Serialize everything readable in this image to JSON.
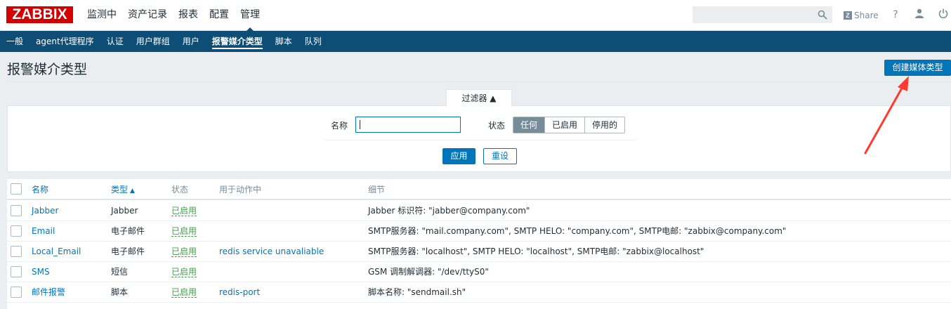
{
  "brand": {
    "logo": "ZABBIX"
  },
  "main_nav": [
    "监测中",
    "资产记录",
    "报表",
    "配置",
    "管理"
  ],
  "main_nav_active": 4,
  "header_tools": {
    "search_value": "",
    "share_label": "Share",
    "help_glyph": "?",
    "user_glyph": "👤",
    "power_glyph": "⏻"
  },
  "sub_nav": [
    "一般",
    "agent代理程序",
    "认证",
    "用户群组",
    "用户",
    "报警媒介类型",
    "脚本",
    "队列"
  ],
  "sub_nav_active": 5,
  "page": {
    "title": "报警媒介类型",
    "create_button": "创建媒体类型"
  },
  "filter": {
    "tab_label": "过滤器 ▲",
    "name_label": "名称",
    "name_value": "",
    "status_label": "状态",
    "status_options": [
      "任何",
      "已启用",
      "停用的"
    ],
    "status_selected": 0,
    "apply_label": "应用",
    "reset_label": "重设"
  },
  "table": {
    "headers": {
      "name": "名称",
      "type": "类型",
      "type_sort": "▲",
      "status": "状态",
      "used_in_actions": "用于动作中",
      "details": "细节"
    },
    "rows": [
      {
        "name": "Jabber",
        "type": "Jabber",
        "status": "已启用",
        "actions": "",
        "details": "Jabber 标识符: \"jabber@company.com\""
      },
      {
        "name": "Email",
        "type": "电子邮件",
        "status": "已启用",
        "actions": "",
        "details": "SMTP服务器: \"mail.company.com\", SMTP HELO: \"company.com\", SMTP电邮: \"zabbix@company.com\""
      },
      {
        "name": "Local_Email",
        "type": "电子邮件",
        "status": "已启用",
        "actions": "redis service unavaliable",
        "details": "SMTP服务器: \"localhost\", SMTP HELO: \"localhost\", SMTP电邮: \"zabbix@localhost\""
      },
      {
        "name": "SMS",
        "type": "短信",
        "status": "已启用",
        "actions": "",
        "details": "GSM 调制解调器: \"/dev/ttyS0\""
      },
      {
        "name": "邮件报警",
        "type": "脚本",
        "status": "已启用",
        "actions": "redis-port",
        "details": "脚本名称: \"sendmail.sh\""
      }
    ]
  },
  "colors": {
    "accent": "#0275b8",
    "nav_dark": "#0e4d75",
    "logo_red": "#d40000",
    "enabled_green": "#429e47",
    "annotation_red": "#ff3b30"
  }
}
